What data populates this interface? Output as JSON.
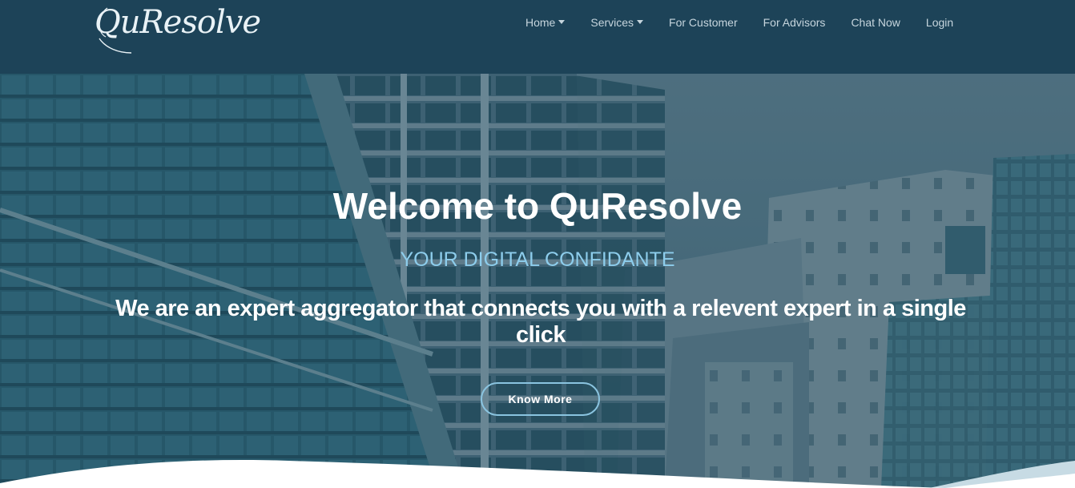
{
  "navbar": {
    "logo_text": "QuResolve",
    "items": [
      {
        "label": "Home",
        "dropdown": true
      },
      {
        "label": "Services",
        "dropdown": true
      },
      {
        "label": "For Customer",
        "dropdown": false
      },
      {
        "label": "For Advisors",
        "dropdown": false
      },
      {
        "label": "Chat Now",
        "dropdown": false
      },
      {
        "label": "Login",
        "dropdown": false
      }
    ],
    "icons": {
      "dropdown": "caret-down-icon"
    },
    "colors": {
      "background": "#1d4358",
      "text": "#c6d5dd"
    }
  },
  "hero": {
    "title": "Welcome to QuResolve",
    "subtitle": "YOUR DIGITAL CONFIDANTE",
    "lead": "We are an expert aggregator that connects you with a relevent expert in a single click",
    "cta_label": "Know More",
    "colors": {
      "subtitle": "#8dcdec",
      "cta_border": "#8ac4e0",
      "overlay": "#183e54"
    }
  }
}
